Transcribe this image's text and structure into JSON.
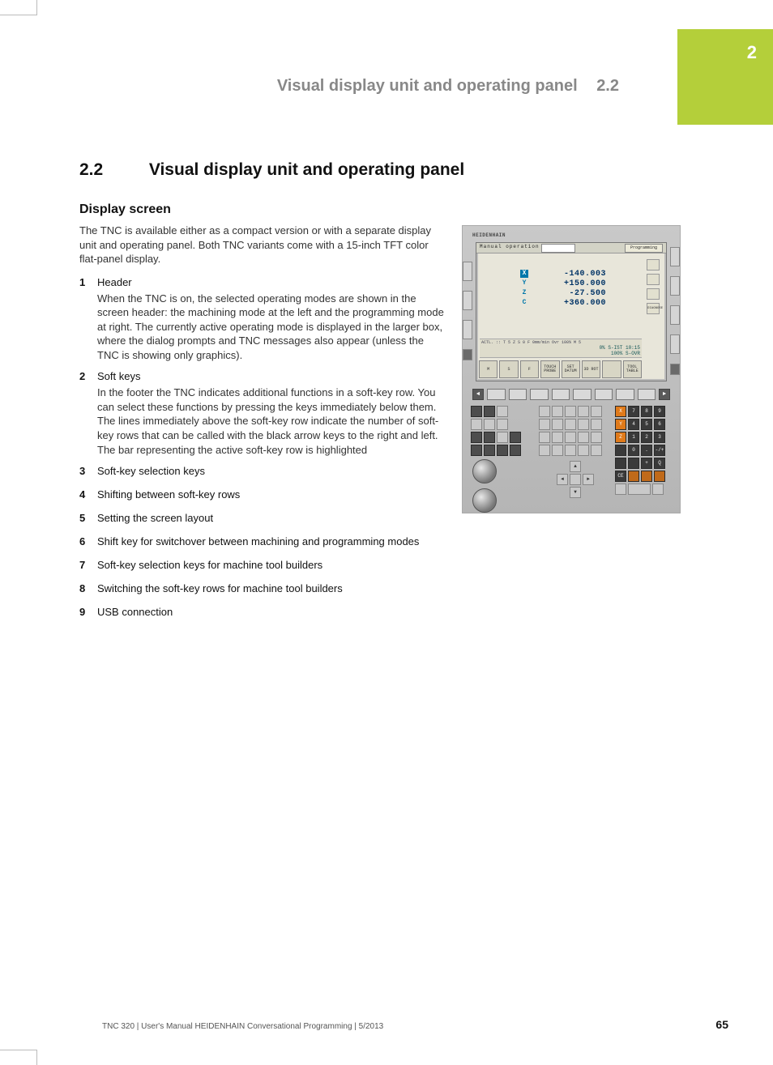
{
  "chapter_tab": "2",
  "running_head": {
    "title": "Visual display unit and operating panel",
    "number": "2.2"
  },
  "section": {
    "number": "2.2",
    "title": "Visual display unit and operating panel"
  },
  "subheading": "Display screen",
  "intro": "The TNC is available either as a compact version or with a separate display unit and operating panel. Both TNC variants come with a 15-inch TFT color flat-panel display.",
  "items": [
    {
      "n": "1",
      "label": "Header",
      "desc": "When the TNC is on, the selected operating modes are shown in the screen header: the machining mode at the left and the programming mode at right. The currently active operating mode is displayed in the larger box, where the dialog prompts and TNC messages also appear (unless the TNC is showing only graphics)."
    },
    {
      "n": "2",
      "label": "Soft keys",
      "desc": "In the footer the TNC indicates additional functions in a soft-key row. You can select these functions by pressing the keys immediately below them. The lines immediately above the soft-key row indicate the number of soft-key rows that can be called with the black arrow keys to the right and left. The bar representing the active soft-key row is highlighted"
    },
    {
      "n": "3",
      "label": "Soft-key selection keys",
      "desc": ""
    },
    {
      "n": "4",
      "label": "Shifting between soft-key rows",
      "desc": ""
    },
    {
      "n": "5",
      "label": "Setting the screen layout",
      "desc": ""
    },
    {
      "n": "6",
      "label": "Shift key for switchover between machining and programming modes",
      "desc": ""
    },
    {
      "n": "7",
      "label": "Soft-key selection keys for machine tool builders",
      "desc": ""
    },
    {
      "n": "8",
      "label": "Switching the soft-key rows for machine tool builders",
      "desc": ""
    },
    {
      "n": "9",
      "label": "USB connection",
      "desc": ""
    }
  ],
  "footer": {
    "left": "TNC 320 | User's Manual HEIDENHAIN Conversational Programming | 5/2013",
    "page": "65"
  },
  "figure": {
    "brand": "HEIDENHAIN",
    "header_mode": "Manual operation",
    "header_prog": "Programming",
    "axes": [
      {
        "label": "X",
        "value": "-140.003",
        "highlight": true
      },
      {
        "label": "Y",
        "value": "+150.000",
        "highlight": false
      },
      {
        "label": "Z",
        "value": "-27.500",
        "highlight": false
      },
      {
        "label": "C",
        "value": "+360.000",
        "highlight": false
      }
    ],
    "status_small": "ACTL.   ::      T  5  Z  S   0   F   0mm/min   Ovr  100%   M 5",
    "status_line1": "0% S-IST 10:15",
    "status_line2": "100% S-OVR",
    "softkeys": [
      "M",
      "S",
      "F",
      "TOUCH PROBE",
      "SET DATUM",
      "3D ROT",
      "",
      "TOOL TABLE"
    ],
    "numpad": [
      "7",
      "8",
      "9",
      "4",
      "5",
      "6",
      "1",
      "2",
      "3",
      "0",
      ".",
      "-/+"
    ]
  }
}
